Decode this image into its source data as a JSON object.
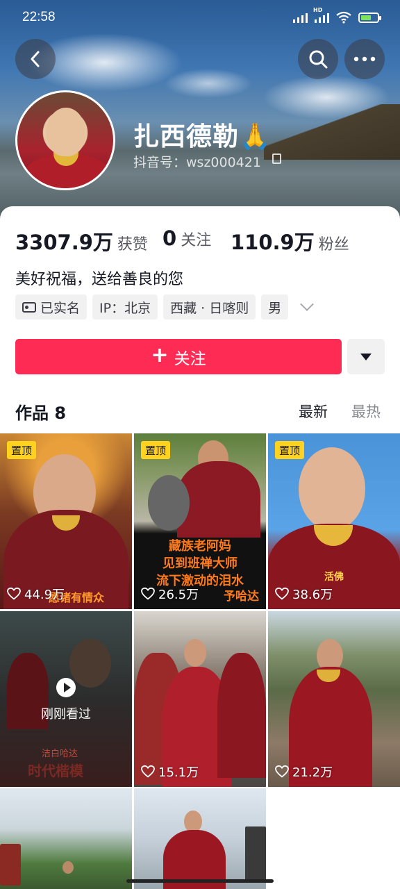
{
  "status_bar": {
    "time": "22:58",
    "network": "HD"
  },
  "profile": {
    "name": "扎西德勒🙏",
    "douyin_id": "抖音号：wsz000421",
    "bio": "美好祝福，送给善良的您"
  },
  "stats": {
    "likes": {
      "value": "3307.9万",
      "label": "获赞"
    },
    "following": {
      "value": "0",
      "label": "关注"
    },
    "followers": {
      "value": "110.9万",
      "label": "粉丝"
    }
  },
  "tags": [
    "已实名",
    "IP：北京",
    "西藏 · 日喀则",
    "男"
  ],
  "actions": {
    "follow_label": "关注"
  },
  "works": {
    "title": "作品 8",
    "sort_latest": "最新",
    "sort_hot": "最热",
    "items": [
      {
        "pinned": "置顶",
        "likes": "44.9万",
        "caption": "愿诸有情众"
      },
      {
        "pinned": "置顶",
        "likes": "26.5万",
        "caption_lines": [
          "藏族老阿妈",
          "见到班禅大师",
          "流下激动的泪水"
        ],
        "caption_tail": "予哈达"
      },
      {
        "pinned": "置顶",
        "likes": "38.6万",
        "caption": "活佛"
      },
      {
        "watched": "刚刚看过",
        "caption": "时代楷模",
        "caption_small": "洁白哈达"
      },
      {
        "likes": "15.1万"
      },
      {
        "likes": "21.2万"
      },
      {},
      {}
    ]
  },
  "colors": {
    "accent": "#fe2c55",
    "pin": "#ffd21f"
  }
}
